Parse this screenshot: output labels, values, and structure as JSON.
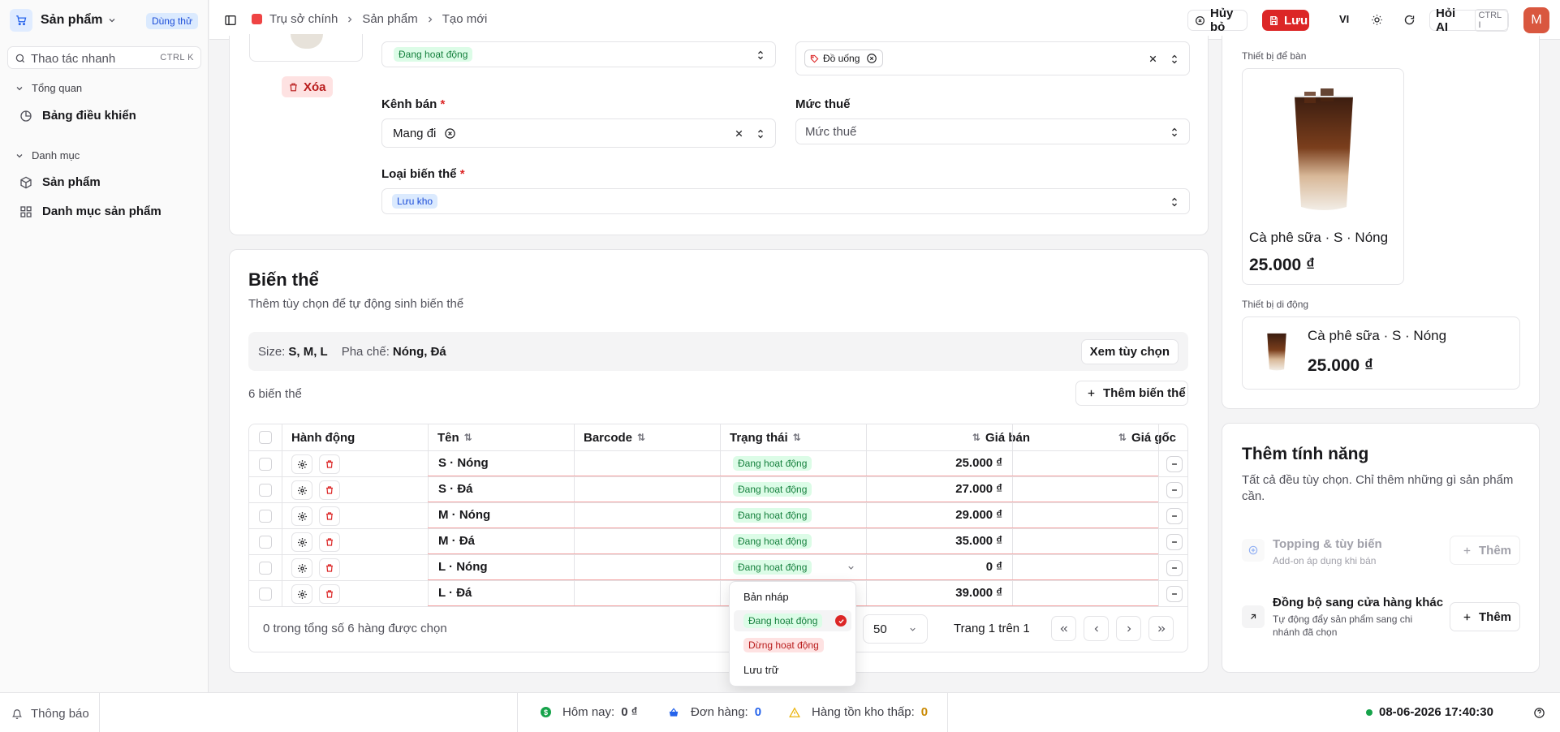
{
  "sidebar": {
    "brand": "Sản phẩm",
    "trial_badge": "Dùng thử",
    "quick_action": {
      "placeholder": "Thao tác nhanh",
      "shortcut": "CTRL K"
    },
    "sections": [
      {
        "title": "Tổng quan",
        "items": [
          "Bảng điều khiển"
        ]
      },
      {
        "title": "Danh mục",
        "items": [
          "Sản phẩm",
          "Danh mục sản phẩm"
        ]
      }
    ]
  },
  "header": {
    "breadcrumb": [
      "Trụ sở chính",
      "Sản phẩm",
      "Tạo mới"
    ],
    "cancel_label": "Hủy bỏ",
    "save_label": "Lưu",
    "lang": "VI",
    "ai_label": "Hỏi AI",
    "ai_shortcut": "CTRL I",
    "avatar": "M"
  },
  "form": {
    "delete_label": "Xóa",
    "status_value": "Đang hoạt động",
    "category_chip": "Đồ uống",
    "channel_label": "Kênh bán",
    "channel_value": "Mang đi",
    "tax_label": "Mức thuế",
    "tax_placeholder": "Mức thuế",
    "variant_type_label": "Loại biến thể",
    "variant_type_value": "Lưu kho"
  },
  "variants": {
    "title": "Biến thể",
    "subtitle": "Thêm tùy chọn để tự động sinh biến thể",
    "options": [
      {
        "label": "Size:",
        "value": "S, M, L"
      },
      {
        "label": "Pha chế:",
        "value": "Nóng, Đá"
      }
    ],
    "view_options_label": "Xem tùy chọn",
    "count_label": "6 biến thể",
    "add_variant_label": "Thêm biến thể",
    "columns": [
      "Hành động",
      "Tên",
      "Barcode",
      "Trạng thái",
      "Giá bán",
      "Giá gốc"
    ],
    "rows": [
      {
        "name": "S · Nóng",
        "status": "Đang hoạt động",
        "price": "25.000 ₫"
      },
      {
        "name": "S · Đá",
        "status": "Đang hoạt động",
        "price": "27.000 ₫"
      },
      {
        "name": "M · Nóng",
        "status": "Đang hoạt động",
        "price": "29.000 ₫"
      },
      {
        "name": "M · Đá",
        "status": "Đang hoạt động",
        "price": "35.000 ₫"
      },
      {
        "name": "L · Nóng",
        "status": "Đang hoạt động",
        "price": "0 ₫"
      },
      {
        "name": "L · Đá",
        "status": "",
        "price": "39.000 ₫"
      }
    ],
    "selection_summary": "0 trong tổng số 6 hàng được chọn",
    "page_size": "50",
    "page_info": "Trang 1 trên 1"
  },
  "status_dropdown": {
    "options": [
      "Bản nháp",
      "Đang hoạt động",
      "Dừng hoạt động",
      "Lưu trữ"
    ],
    "selected": "Đang hoạt động"
  },
  "preview": {
    "desktop_label": "Thiết bị để bàn",
    "mobile_label": "Thiết bị di động",
    "product_name": "Cà phê sữa · S · Nóng",
    "price": "25.000 ₫"
  },
  "features": {
    "title": "Thêm tính năng",
    "subtitle": "Tất cả đều tùy chọn. Chỉ thêm những gì sản phẩm cần.",
    "items": [
      {
        "title": "Topping & tùy biến",
        "desc": "Add-on áp dụng khi bán",
        "action": "Thêm",
        "enabled": false
      },
      {
        "title": "Đồng bộ sang cửa hàng khác",
        "desc": "Tự động đẩy sản phẩm sang chi nhánh đã chọn",
        "action": "Thêm",
        "enabled": true
      }
    ]
  },
  "footer": {
    "notifications": "Thông báo",
    "today_label": "Hôm nay:",
    "today_value": "0 ₫",
    "orders_label": "Đơn hàng:",
    "orders_value": "0",
    "low_stock_label": "Hàng tồn kho thấp:",
    "low_stock_value": "0",
    "datetime": "08-06-2026 17:40:30"
  },
  "colors": {
    "primary": "#dc2626",
    "accent_blue": "#2563eb",
    "success": "#16a34a",
    "warning": "#eab308"
  }
}
